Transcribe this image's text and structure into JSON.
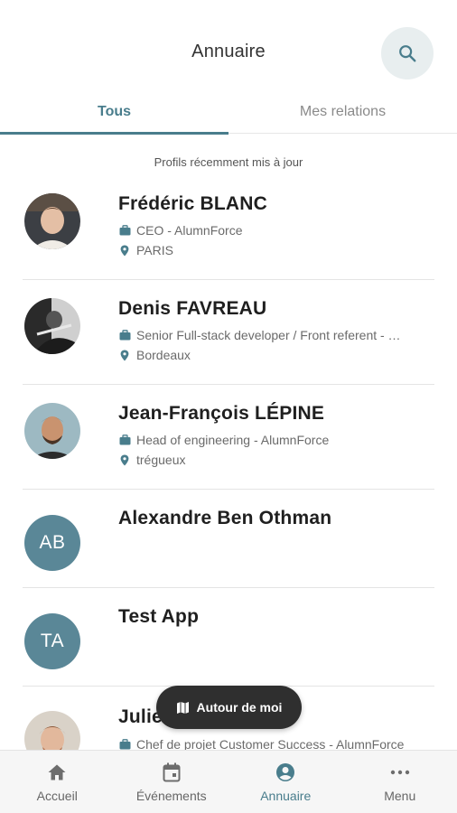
{
  "header": {
    "title": "Annuaire"
  },
  "tabs": [
    {
      "label": "Tous",
      "active": true
    },
    {
      "label": "Mes relations",
      "active": false
    }
  ],
  "section": {
    "caption": "Profils récemment mis à jour"
  },
  "profiles": [
    {
      "name": "Frédéric BLANC",
      "job": "CEO - AlumnForce",
      "location": "PARIS",
      "avatar": "photo"
    },
    {
      "name": "Denis FAVREAU",
      "job": "Senior Full-stack developer / Front referent - …",
      "location": "Bordeaux",
      "avatar": "photo"
    },
    {
      "name": "Jean-François LÉPINE",
      "job": "Head of engineering - AlumnForce",
      "location": "trégueux",
      "avatar": "photo"
    },
    {
      "name": "Alexandre Ben Othman",
      "initials": "AB",
      "avatar": "initials"
    },
    {
      "name": "Test App",
      "initials": "TA",
      "avatar": "initials"
    },
    {
      "name": "Julie",
      "job": "Chef de projet Customer Success - AlumnForce",
      "avatar": "photo"
    }
  ],
  "floating_button": {
    "label": "Autour de moi",
    "icon": "map-icon"
  },
  "bottom_nav": [
    {
      "label": "Accueil",
      "icon": "home-icon",
      "active": false
    },
    {
      "label": "Événements",
      "icon": "calendar-icon",
      "active": false
    },
    {
      "label": "Annuaire",
      "icon": "account-circle-icon",
      "active": true
    },
    {
      "label": "Menu",
      "icon": "more-dots-icon",
      "active": false
    }
  ],
  "colors": {
    "accent": "#497d8c",
    "avatar_bg": "#5a8797",
    "float_bg": "#2f2f2f",
    "nav_bg": "#f6f6f6"
  }
}
